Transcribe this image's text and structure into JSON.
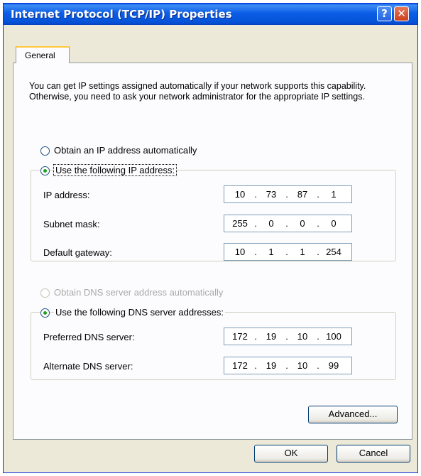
{
  "window": {
    "title": "Internet Protocol (TCP/IP) Properties",
    "help_glyph": "?",
    "close_glyph": "✕"
  },
  "tabs": [
    {
      "label": "General"
    }
  ],
  "intro": "You can get IP settings assigned automatically if your network supports this capability. Otherwise, you need to ask your network administrator for the appropriate IP settings.",
  "ip_mode": {
    "auto_label": "Obtain an IP address automatically",
    "manual_label": "Use the following IP address:",
    "selected": "manual"
  },
  "ip_fields": [
    {
      "label": "IP address:",
      "octets": [
        "10",
        "73",
        "87",
        "1"
      ]
    },
    {
      "label": "Subnet mask:",
      "octets": [
        "255",
        "0",
        "0",
        "0"
      ]
    },
    {
      "label": "Default gateway:",
      "octets": [
        "10",
        "1",
        "1",
        "254"
      ]
    }
  ],
  "dns_mode": {
    "auto_label": "Obtain DNS server address automatically",
    "manual_label": "Use the following DNS server addresses:",
    "selected": "manual",
    "auto_disabled": true
  },
  "dns_fields": [
    {
      "label": "Preferred DNS server:",
      "octets": [
        "172",
        "19",
        "10",
        "100"
      ]
    },
    {
      "label": "Alternate DNS server:",
      "octets": [
        "172",
        "19",
        "10",
        "99"
      ]
    }
  ],
  "buttons": {
    "advanced": "Advanced...",
    "ok": "OK",
    "cancel": "Cancel"
  },
  "colors": {
    "title_bar": "#0552d7",
    "dialog_bg": "#ece9d8",
    "radio_dot": "#21a121",
    "tab_highlight": "#ffc83c"
  }
}
